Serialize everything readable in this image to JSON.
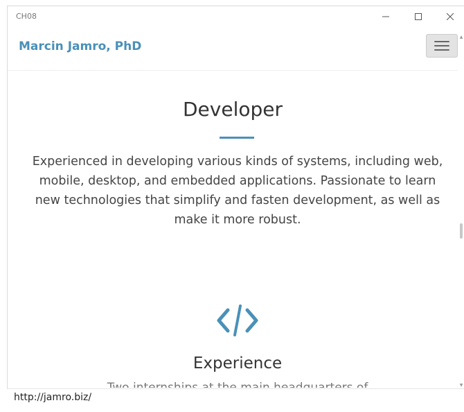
{
  "window": {
    "title": "CH08"
  },
  "navbar": {
    "brand": "Marcin Jamro, PhD"
  },
  "section": {
    "heading": "Developer",
    "paragraph": "Experienced in developing various kinds of systems, including web, mobile, desktop, and embedded applications. Passionate to learn new technologies that simplify and fasten development, as well as make it more robust."
  },
  "experience": {
    "icon": "code-icon",
    "heading": "Experience",
    "paragraph": "Two internships at the main headquarters of"
  },
  "status": {
    "url": "http://jamro.biz/"
  },
  "colors": {
    "accent": "#4a90b8"
  }
}
